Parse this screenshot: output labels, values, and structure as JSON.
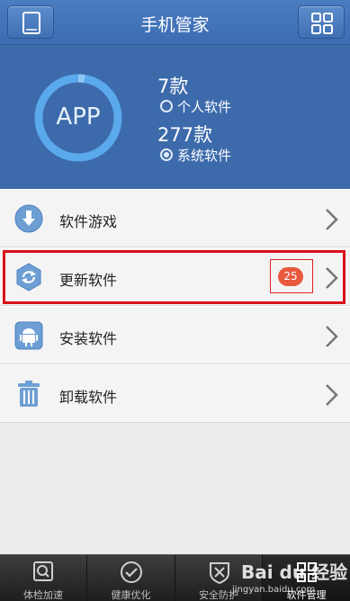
{
  "header": {
    "title": "手机管家",
    "left_icon": "phone-icon",
    "right_icon": "grid-icon"
  },
  "overview": {
    "ring_label": "APP",
    "personal_count": "7款",
    "personal_label": "个人软件",
    "system_count": "277款",
    "system_label": "系统软件",
    "selected": "system"
  },
  "menu": {
    "items": [
      {
        "label": "软件游戏",
        "icon": "download-icon"
      },
      {
        "label": "更新软件",
        "icon": "refresh-icon",
        "badge": "25"
      },
      {
        "label": "安装软件",
        "icon": "android-icon"
      },
      {
        "label": "卸载软件",
        "icon": "trash-icon"
      }
    ]
  },
  "tabbar": {
    "tabs": [
      {
        "label": "体检加速",
        "icon": "scan-icon"
      },
      {
        "label": "健康优化",
        "icon": "check-circle-icon"
      },
      {
        "label": "安全防护",
        "icon": "shield-icon"
      },
      {
        "label": "软件管理",
        "icon": "grid-icon",
        "active": true
      }
    ]
  },
  "watermark": {
    "brand": "Bai du 经验",
    "url": "jingyan.baidu.com"
  },
  "colors": {
    "header_blue": "#3c6db3",
    "hero_blue": "#3c6aab",
    "ring_blue": "#5aa9ec",
    "badge": "#e8593e",
    "highlight": "#d8101a"
  }
}
